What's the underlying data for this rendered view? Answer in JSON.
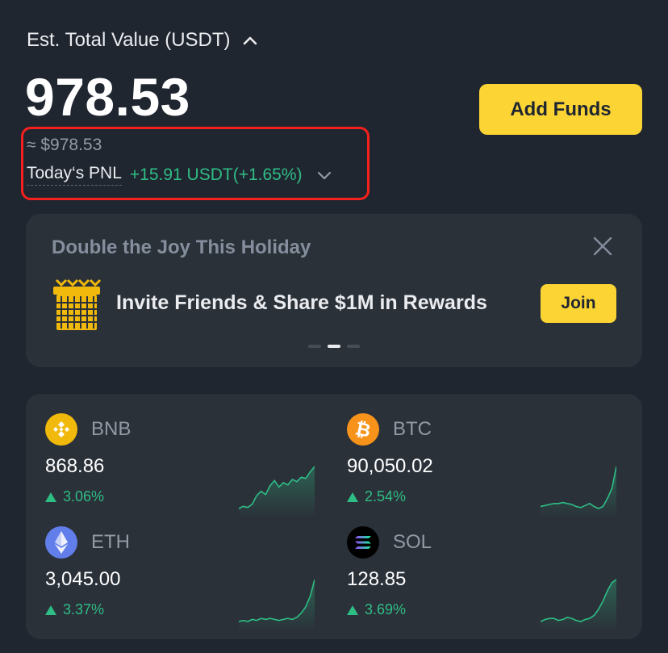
{
  "header": {
    "est_label": "Est. Total Value (USDT)",
    "total_value": "978.53",
    "approx_usd": "≈ $978.53",
    "pnl_label": "Today‘s PNL",
    "pnl_value": "+15.91 USDT(+1.65%)",
    "add_funds_label": "Add Funds"
  },
  "banner": {
    "title": "Double the Joy This Holiday",
    "text": "Invite Friends & Share $1M in Rewards",
    "join_label": "Join",
    "page_indicator": {
      "count": 3,
      "active": 2
    }
  },
  "coins": [
    {
      "symbol": "BNB",
      "price": "868.86",
      "change": "3.06%",
      "icon": "bnb-icon",
      "color": "#f0b90b",
      "spark": [
        3,
        3.2,
        3.1,
        3.4,
        4.2,
        4.6,
        4.3,
        5.1,
        5.6,
        5.0,
        5.4,
        5.2,
        5.7,
        5.5,
        5.9,
        5.8,
        6.4,
        6.9
      ]
    },
    {
      "symbol": "BTC",
      "price": "90,050.02",
      "change": "2.54%",
      "icon": "btc-icon",
      "color": "#f7931a",
      "spark": [
        3.0,
        3.1,
        3.2,
        3.3,
        3.3,
        3.4,
        3.3,
        3.2,
        3.0,
        2.9,
        3.1,
        3.3,
        3.0,
        2.8,
        3.0,
        3.8,
        4.8,
        7.0
      ]
    },
    {
      "symbol": "ETH",
      "price": "3,045.00",
      "change": "3.37%",
      "icon": "eth-icon",
      "color": "#627eea",
      "spark": [
        3.0,
        3.1,
        3.0,
        3.2,
        3.1,
        3.3,
        3.2,
        3.3,
        3.2,
        3.1,
        3.2,
        3.3,
        3.2,
        3.4,
        3.8,
        4.4,
        5.4,
        7.0
      ]
    },
    {
      "symbol": "SOL",
      "price": "128.85",
      "change": "3.69%",
      "icon": "sol-icon",
      "color": "#000000",
      "spark": [
        3.0,
        3.2,
        3.3,
        3.3,
        3.1,
        3.2,
        3.4,
        3.3,
        3.1,
        3.0,
        3.2,
        3.3,
        3.6,
        4.2,
        5.0,
        6.0,
        6.8,
        7.1
      ]
    }
  ],
  "colors": {
    "accent": "#fcd535",
    "positive": "#2ebd85",
    "highlight": "#f6211c",
    "background": "#202630",
    "card": "#2b3139"
  }
}
